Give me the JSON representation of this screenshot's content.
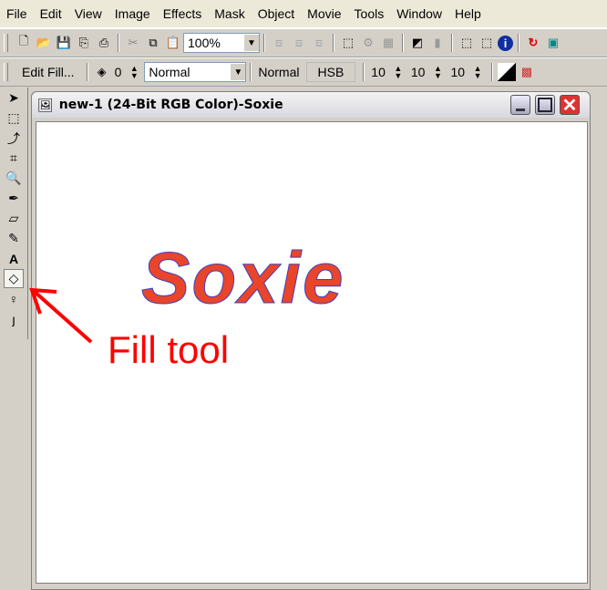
{
  "menu": [
    "File",
    "Edit",
    "View",
    "Image",
    "Effects",
    "Mask",
    "Object",
    "Movie",
    "Tools",
    "Window",
    "Help"
  ],
  "toolbar1": {
    "zoom": "100%"
  },
  "toolbar2": {
    "edit_fill": "Edit Fill...",
    "opacity": "0",
    "blend_mode": "Normal",
    "normal_label": "Normal",
    "color_model": "HSB",
    "h": "10",
    "s": "10",
    "b": "10"
  },
  "document": {
    "title": "new-1  (24-Bit RGB Color)-Soxie",
    "canvas_text": "Soxie"
  },
  "annotation": {
    "label": "Fill tool",
    "color": "#ff0000"
  },
  "colors": {
    "text_fill": "#e8452a"
  }
}
